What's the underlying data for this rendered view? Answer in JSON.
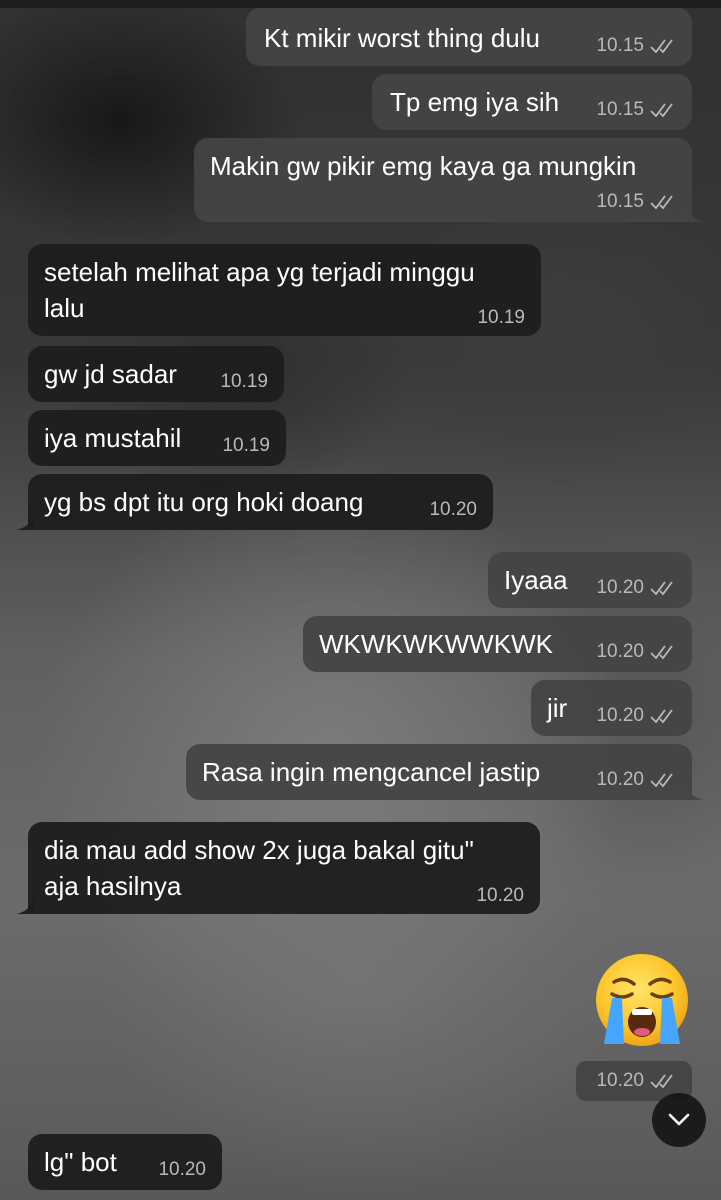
{
  "chat": {
    "messages": [
      {
        "text": "Kt mikir worst thing dulu",
        "time": "10.15"
      },
      {
        "text": "Tp emg iya sih",
        "time": "10.15"
      },
      {
        "text": "Makin gw pikir emg kaya ga mungkin",
        "time": "10.15"
      },
      {
        "text_line1": "setelah melihat apa yg terjadi minggu",
        "text_line2": "lalu",
        "time": "10.19"
      },
      {
        "text": "gw jd sadar",
        "time": "10.19"
      },
      {
        "text": "iya mustahil",
        "time": "10.19"
      },
      {
        "text": "yg bs dpt itu org hoki doang",
        "time": "10.20"
      },
      {
        "text": "Iyaaa",
        "time": "10.20"
      },
      {
        "text": "WKWKWKWWKWK",
        "time": "10.20"
      },
      {
        "text": "jir",
        "time": "10.20"
      },
      {
        "text": "Rasa ingin mengcancel jastip",
        "time": "10.20"
      },
      {
        "text_line1": "dia mau add show 2x juga bakal gitu\"",
        "text_line2": "aja hasilnya",
        "time": "10.20"
      },
      {
        "emoji": "loudly-crying-face",
        "time": "10.20"
      },
      {
        "text": "lg\" bot",
        "time": "10.20"
      }
    ],
    "read_status_icon": "double-check-icon",
    "scroll_button_icon": "chevron-down-icon"
  },
  "colors": {
    "outgoing_bubble": "#444444",
    "incoming_bubble": "#1e1e1e",
    "text": "#ffffff",
    "timestamp": "#b9b9b9"
  }
}
